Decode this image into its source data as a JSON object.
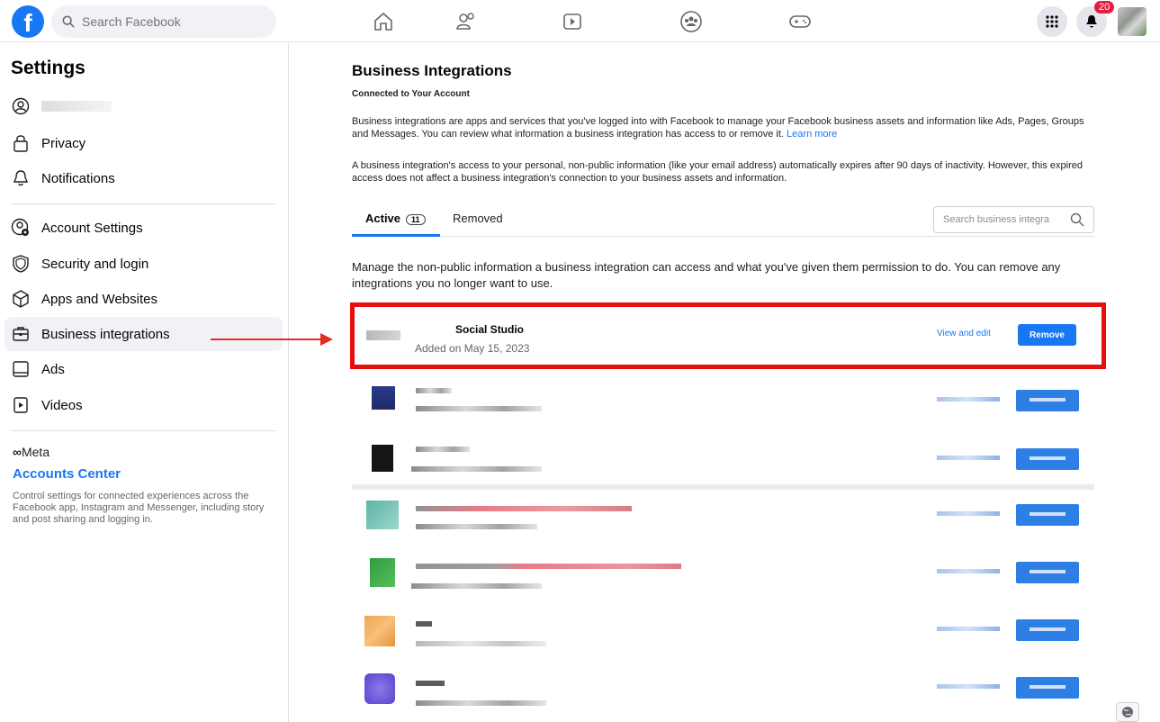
{
  "topbar": {
    "search_placeholder": "Search Facebook",
    "notification_count": "20"
  },
  "sidebar": {
    "title": "Settings",
    "items": [
      {
        "label": "",
        "icon": "account-circle-icon"
      },
      {
        "label": "Privacy",
        "icon": "lock-icon"
      },
      {
        "label": "Notifications",
        "icon": "bell-icon"
      },
      {
        "label": "Account Settings",
        "icon": "account-settings-icon"
      },
      {
        "label": "Security and login",
        "icon": "shield-icon"
      },
      {
        "label": "Apps and Websites",
        "icon": "cube-icon"
      },
      {
        "label": "Business integrations",
        "icon": "briefcase-icon"
      },
      {
        "label": "Ads",
        "icon": "ads-icon"
      },
      {
        "label": "Videos",
        "icon": "video-icon"
      }
    ],
    "meta_label": "Meta",
    "accounts_center": "Accounts Center",
    "accounts_center_desc": "Control settings for connected experiences across the Facebook app, Instagram and Messenger, including story and post sharing and logging in."
  },
  "main": {
    "title": "Business Integrations",
    "subtitle": "Connected to Your Account",
    "para1": "Business integrations are apps and services that you've logged into with Facebook to manage your Facebook business assets and information like Ads, Pages, Groups and Messages. You can review what information a business integration has access to or remove it.",
    "learn_more": "Learn more",
    "para2": "A business integration's access to your personal, non-public information (like your email address) automatically expires after 90 days of inactivity. However, this expired access does not affect a business integration's connection to your business assets and information.",
    "tab_active": "Active",
    "tab_active_count": "11",
    "tab_removed": "Removed",
    "search_placeholder": "Search business integra",
    "manage_text": "Manage the non-public information a business integration can access and what you've given them permission to do. You can remove any integrations you no longer want to use."
  },
  "integration": {
    "name": "Social Studio",
    "added": "Added on May 15, 2023",
    "view_edit": "View and edit",
    "remove": "Remove"
  },
  "colors": {
    "brand": "#1877f2",
    "highlight": "#e3100f"
  }
}
